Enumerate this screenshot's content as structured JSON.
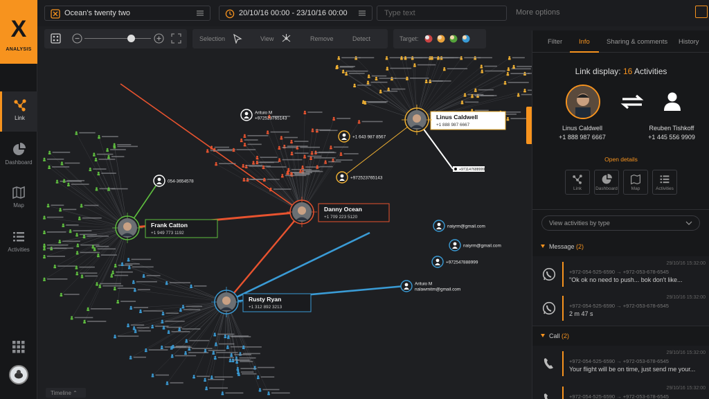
{
  "brand": {
    "mark": "X",
    "name": "ANALYSIS",
    "accent": "#f7931e"
  },
  "nav": [
    {
      "label": "Link",
      "icon": "link-icon",
      "active": true
    },
    {
      "label": "Dashboard",
      "icon": "pie-chart-icon",
      "active": false
    },
    {
      "label": "Map",
      "icon": "map-icon",
      "active": false
    },
    {
      "label": "Activities",
      "icon": "list-icon",
      "active": false
    }
  ],
  "topbar": {
    "case_name": "Ocean's twenty two",
    "date_range": "20/10/16  00:00 - 23/10/16  00:00",
    "search_placeholder": "Type text",
    "more_options": "More options"
  },
  "toolbar": {
    "selection": "Selection",
    "view": "View",
    "remove": "Remove",
    "detect": "Detect",
    "target": "Target:",
    "zoom_level": 0.7
  },
  "graph": {
    "main_nodes": [
      {
        "name": "Danny Ocean",
        "phone": "+1 709 223 5120"
      },
      {
        "name": "Frank Catton",
        "phone": "+1 949 773 1192"
      },
      {
        "name": "Rusty Ryan",
        "phone": "+1 312 892 3213"
      },
      {
        "name": "Linus Caldwell",
        "phone": "+1 888 987 6667"
      }
    ],
    "sub_nodes": [
      {
        "line1": "Arituio M",
        "line2": "+9725237651​43"
      },
      {
        "line1": "054-3654578",
        "line2": ""
      },
      {
        "line1": "+1 643 987 8567",
        "line2": ""
      },
      {
        "line1": "+9725237651​43",
        "line2": ""
      },
      {
        "line1": "naiyrm@gmail.com",
        "line2": ""
      },
      {
        "line1": "naiyrm@gmail.com",
        "line2": ""
      },
      {
        "line1": "+9725478889​99",
        "line2": ""
      },
      {
        "line1": "Arituio M",
        "line2": "nalawmitm@gmail.com"
      },
      {
        "line1": "+9711476889​99",
        "line2": ""
      }
    ],
    "timeline_label": "Timeline"
  },
  "panel": {
    "tabs": [
      "Filter",
      "Info",
      "Sharing & comments",
      "History"
    ],
    "active_tab": "Info",
    "link_display_label": "Link display:",
    "link_count": "16",
    "link_unit": "Activities",
    "person_a": {
      "name": "Linus Caldwell",
      "phone": "+1 888 987 6667"
    },
    "person_b": {
      "name": "Reuben Tishkoff",
      "phone": "+1 445 556 9909"
    },
    "open_details": "Open details",
    "mini_buttons": [
      "Link",
      "Dashboard",
      "Map",
      "Activities"
    ],
    "view_by": "View activities by type",
    "message_section": {
      "label": "Message",
      "count": "(2)"
    },
    "call_section": {
      "label": "Call",
      "count": "(2)"
    },
    "messages": [
      {
        "date": "29/10/16  15:32:00",
        "numbers": "+972-054-525-6590  →  +972-053-678-6545",
        "text": "\"Ok ok no need to push... bok don't like..."
      },
      {
        "date": "29/10/16  15:32:00",
        "numbers": "+972-054-525-6590  →  +972-053-678-6545",
        "text": "2 m    47 s"
      }
    ],
    "calls": [
      {
        "date": "29/10/16  15:32:00",
        "numbers": "+972-054-525-6590  →  +972-053-678-6545",
        "text": "Your flight will be on time, just send me your..."
      },
      {
        "date": "29/10/16  15:32:00",
        "numbers": "+972-054-525-6590  →  +972-053-678-6545",
        "text": ""
      }
    ]
  }
}
